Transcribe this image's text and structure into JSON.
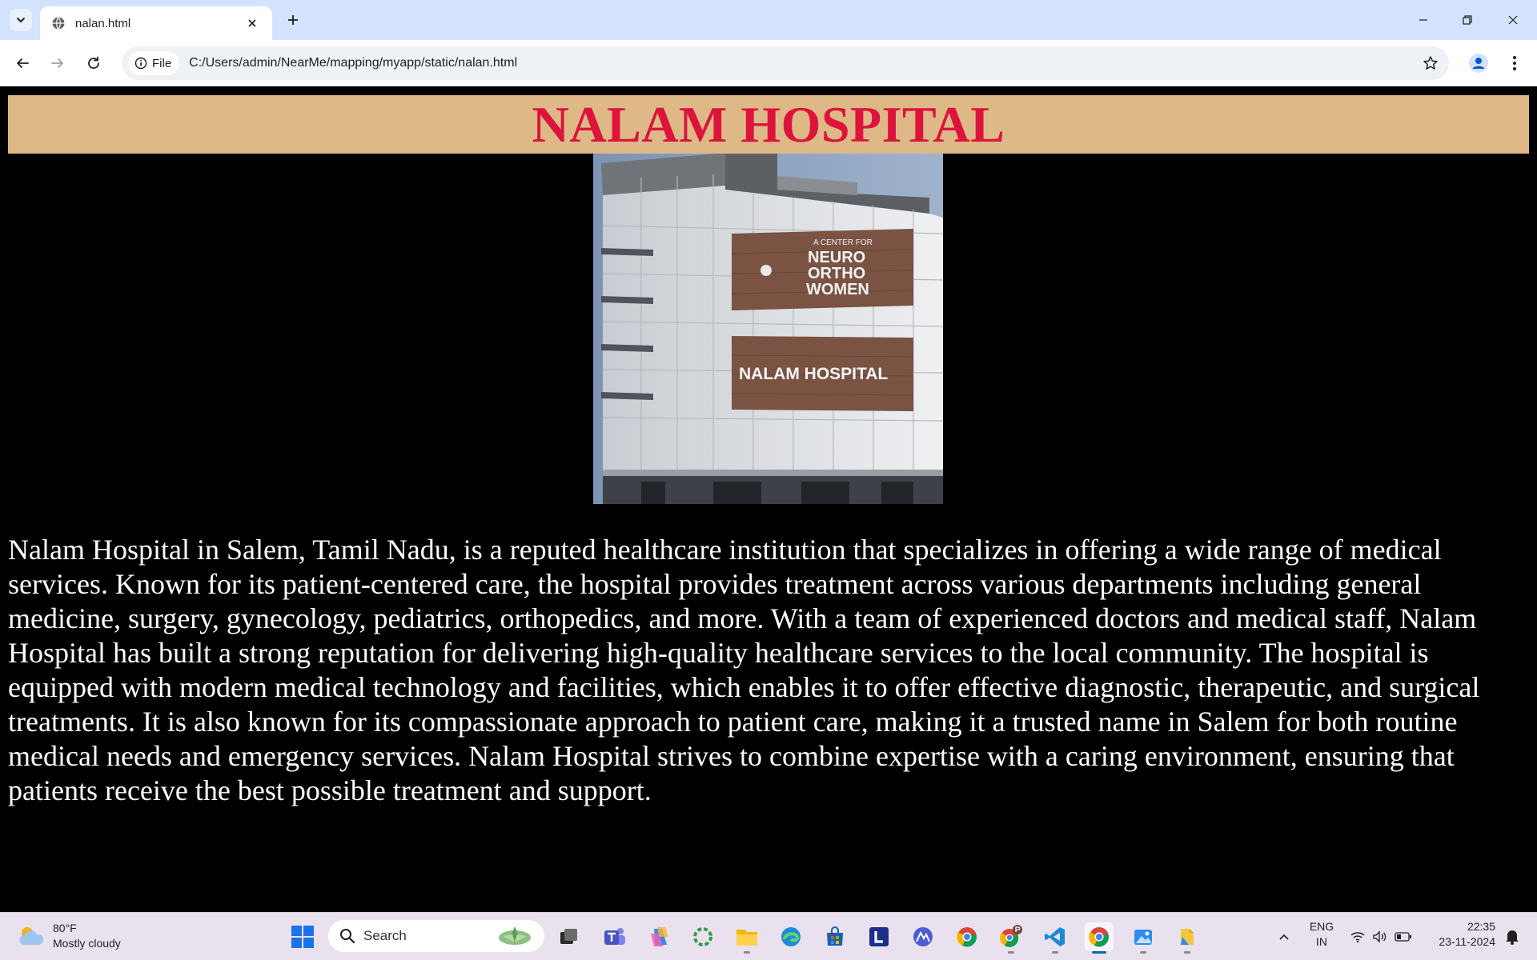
{
  "browser": {
    "tab": {
      "title": "nalan.html"
    },
    "address": {
      "chip_label": "File",
      "url": "C:/Users/admin/NearMe/mapping/myapp/static/nalan.html"
    }
  },
  "page": {
    "title": "NALAM HOSPITAL",
    "image_sign_top": [
      "A CENTER FOR",
      "NEURO",
      "ORTHO",
      "WOMEN"
    ],
    "image_sign_bottom": "NALAM HOSPITAL",
    "description": "Nalam Hospital in Salem, Tamil Nadu, is a reputed healthcare institution that specializes in offering a wide range of medical services. Known for its patient-centered care, the hospital provides treatment across various departments including general medicine, surgery, gynecology, pediatrics, orthopedics, and more. With a team of experienced doctors and medical staff, Nalam Hospital has built a strong reputation for delivering high-quality healthcare services to the local community. The hospital is equipped with modern medical technology and facilities, which enables it to offer effective diagnostic, therapeutic, and surgical treatments. It is also known for its compassionate approach to patient care, making it a trusted name in Salem for both routine medical needs and emergency services. Nalam Hospital strives to combine expertise with a caring environment, ensuring that patients receive the best possible treatment and support."
  },
  "taskbar": {
    "weather": {
      "temp": "80°F",
      "condition": "Mostly cloudy"
    },
    "search_label": "Search",
    "lang": {
      "line1": "ENG",
      "line2": "IN"
    },
    "clock": {
      "time": "22:35",
      "date": "23-11-2024"
    }
  },
  "colors": {
    "header_bg": "#deb887",
    "title_color": "#dc143c",
    "page_bg": "#000000",
    "text_color": "#ffffff",
    "tabstrip_bg": "#d3e3fd",
    "taskbar_bg": "#e9e2ee"
  },
  "icons": [
    "tab-search-icon",
    "globe-icon",
    "close-icon",
    "plus-icon",
    "minimize-icon",
    "restore-icon",
    "back-arrow-icon",
    "forward-arrow-icon",
    "reload-icon",
    "info-icon",
    "star-icon",
    "profile-icon",
    "kebab-menu-icon",
    "weather-cloud-icon",
    "windows-start-icon",
    "search-icon",
    "wifi-icon",
    "volume-icon",
    "battery-icon",
    "notification-bell-icon"
  ]
}
